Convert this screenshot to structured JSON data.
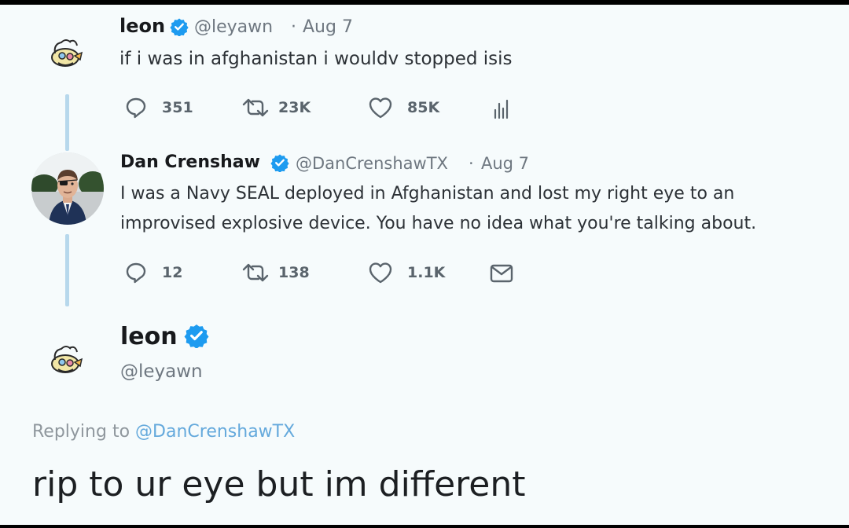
{
  "tweet1": {
    "author_name": "leon",
    "handle": "@leyawn",
    "date": "Aug 7",
    "text": "if i was in afghanistan i wouldv stopped isis",
    "replies": "351",
    "retweets": "23K",
    "likes": "85K",
    "analytics_icon": "analytics-icon"
  },
  "tweet2": {
    "author_name": "Dan Crenshaw",
    "handle": "@DanCrenshawTX",
    "date": "Aug 7",
    "text_line1": "I was a Navy SEAL deployed in Afghanistan and lost my right eye to an",
    "text_line2": "improvised explosive device. You have no idea what you're talking about.",
    "replies": "12",
    "retweets": "138",
    "likes": "1.1K",
    "message_icon": "mail-icon"
  },
  "reply": {
    "author_name": "leon",
    "handle": "@leyawn",
    "replying_prefix": "Replying to",
    "replying_handle": "@DanCrenshawTX",
    "text": "rip to ur eye but im different"
  },
  "colors": {
    "background": "#f6fbfc",
    "verified_blue": "#1d9bf0",
    "link_blue": "#64a9dc",
    "thread_line": "#b7d8ec"
  }
}
